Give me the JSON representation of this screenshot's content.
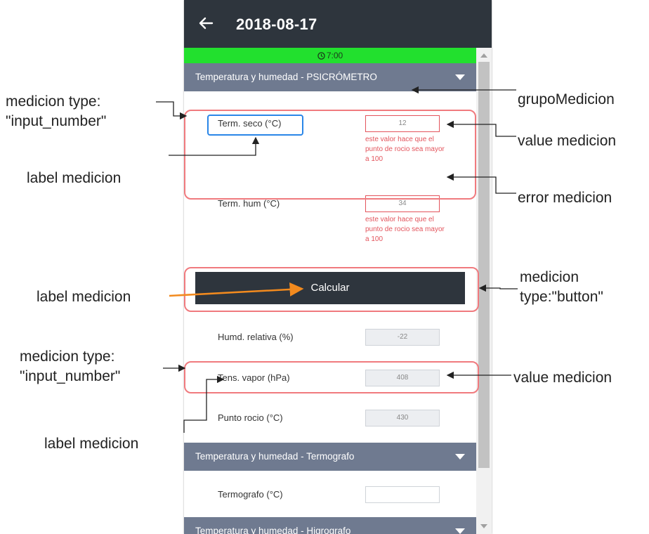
{
  "appbar": {
    "title": "2018-08-17"
  },
  "time_bar": {
    "time": "7:00"
  },
  "groups": [
    {
      "title": "Temperatura y humedad - PSICRÓMETRO"
    },
    {
      "title": "Temperatura y humedad - Termografo"
    },
    {
      "title": "Temperatura y humedad - Higrografo"
    }
  ],
  "fields": {
    "term_seco": {
      "label": "Term. seco (°C)",
      "value": "12",
      "error": "este valor hace que el punto de rocio sea mayor a 100"
    },
    "term_hum": {
      "label": "Term. hum (°C)",
      "value": "34",
      "error": "este valor hace que el punto de rocio sea mayor a 100"
    },
    "calcular": {
      "label": "Calcular"
    },
    "humd_relativa": {
      "label": "Humd. relativa (%)",
      "value": "-22"
    },
    "tens_vapor": {
      "label": "Tens. vapor (hPa)",
      "value": "408"
    },
    "punto_rocio": {
      "label": "Punto rocio (°C)",
      "value": "430"
    },
    "termografo": {
      "label": "Termografo (°C)",
      "value": ""
    }
  },
  "annotations": {
    "medicion_type_1": "medicion type:\n\"input_number\"",
    "label_medicion_1": "label medicion",
    "grupo_medicion": "grupoMedicion",
    "value_medicion_1": "value medicion",
    "error_medicion": "error medicion",
    "label_medicion_2": "label medicion",
    "medicion_button": "medicion\ntype:\"button\"",
    "medicion_type_2": "medicion type:\n\"input_number\"",
    "value_medicion_2": "value medicion",
    "label_medicion_3": "label medicion"
  },
  "colors": {
    "appbar": "#2e353d",
    "time_bar": "#22e02e",
    "group_header": "#6f7a90",
    "error": "#e3545c",
    "highlight": "#f07a7e",
    "arrow_orange": "#f28a1e",
    "label_highlight": "#2a86e8"
  }
}
